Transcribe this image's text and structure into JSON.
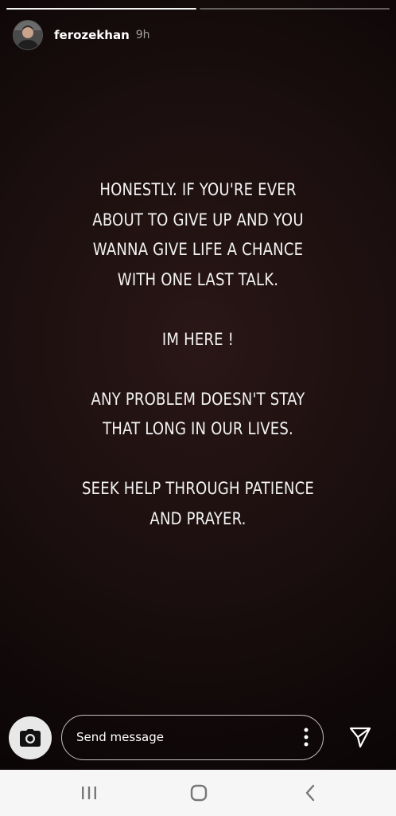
{
  "story": {
    "progress": {
      "segments": 2,
      "active": 0,
      "active_fill": 1.0
    },
    "user": {
      "username": "ferozekhan",
      "time": "9h",
      "avatar_icon": "user-avatar"
    },
    "paragraphs": [
      "HONESTLY. IF YOU'RE EVER\nABOUT TO GIVE UP AND YOU\nWANNA GIVE LIFE A CHANCE\nWITH ONE LAST TALK.",
      "IM HERE !",
      "ANY PROBLEM DOESN'T STAY\nTHAT LONG IN OUR LIVES.",
      "SEEK HELP THROUGH PATIENCE\nAND PRAYER."
    ]
  },
  "reply": {
    "placeholder": "Send message",
    "camera_icon": "camera-icon",
    "more_icon": "more-vertical-icon",
    "send_icon": "send-icon"
  },
  "navbar": {
    "recent_icon": "recent-apps-icon",
    "home_icon": "home-icon",
    "back_icon": "back-icon"
  },
  "colors": {
    "background": "#160b0b",
    "text": "#f2f2f2",
    "navbar": "#f6f6f6"
  }
}
